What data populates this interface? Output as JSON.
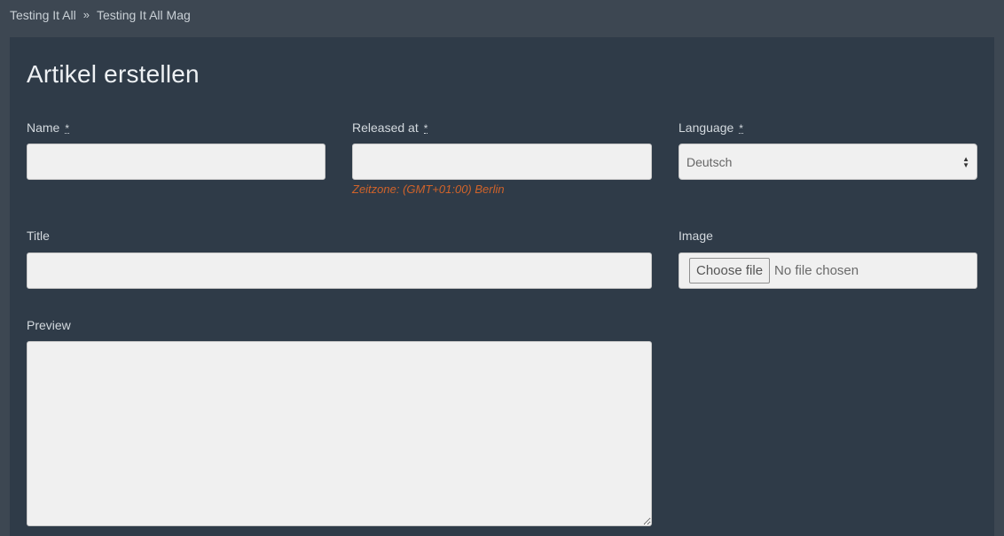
{
  "breadcrumb": {
    "items": [
      "Testing It All",
      "Testing It All Mag"
    ],
    "separator": "»"
  },
  "form": {
    "title": "Artikel erstellen",
    "required_marker": "*",
    "name": {
      "label": "Name",
      "value": ""
    },
    "released_at": {
      "label": "Released at",
      "value": "",
      "hint": "Zeitzone: (GMT+01:00) Berlin"
    },
    "language": {
      "label": "Language",
      "selected": "Deutsch"
    },
    "title_field": {
      "label": "Title",
      "value": ""
    },
    "image": {
      "label": "Image",
      "button_label": "Choose file",
      "status": "No file chosen"
    },
    "preview": {
      "label": "Preview",
      "value": ""
    }
  },
  "colors": {
    "background": "#3d4752",
    "panel": "#2f3b48",
    "hint": "#d0632a",
    "input": "#f0f0f0"
  }
}
